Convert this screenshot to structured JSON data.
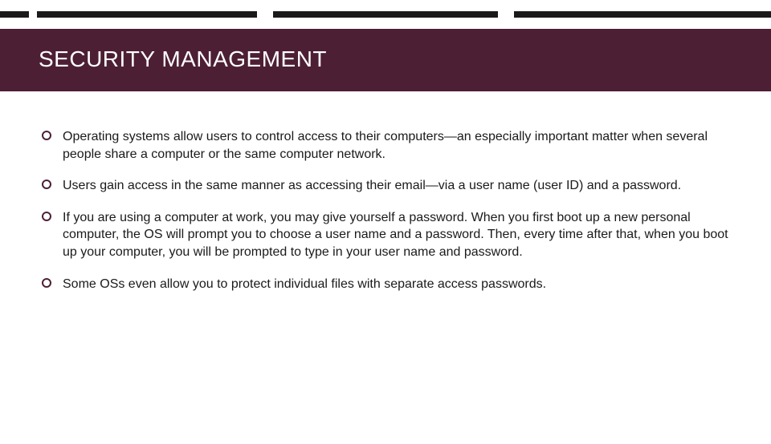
{
  "title": "SECURITY MANAGEMENT",
  "bullets": [
    {
      "text": "Operating systems allow users to control access to their computers—an especially important matter when several people share a computer or the same computer network."
    },
    {
      "text": "Users gain access in the same manner as accessing their email—via a user name (user ID) and a password."
    },
    {
      "text": "If you are using a computer at work, you may give yourself a password. When you first boot up a new personal computer, the OS will prompt you to choose a user name and a password. Then, every time after that, when you boot up your computer, you will be prompted to type in your user name and password."
    },
    {
      "text": "Some OSs even allow you to protect individual files with separate access passwords."
    }
  ],
  "colors": {
    "accent": "#4d1f34",
    "bar_dark": "#1a1a1a"
  }
}
